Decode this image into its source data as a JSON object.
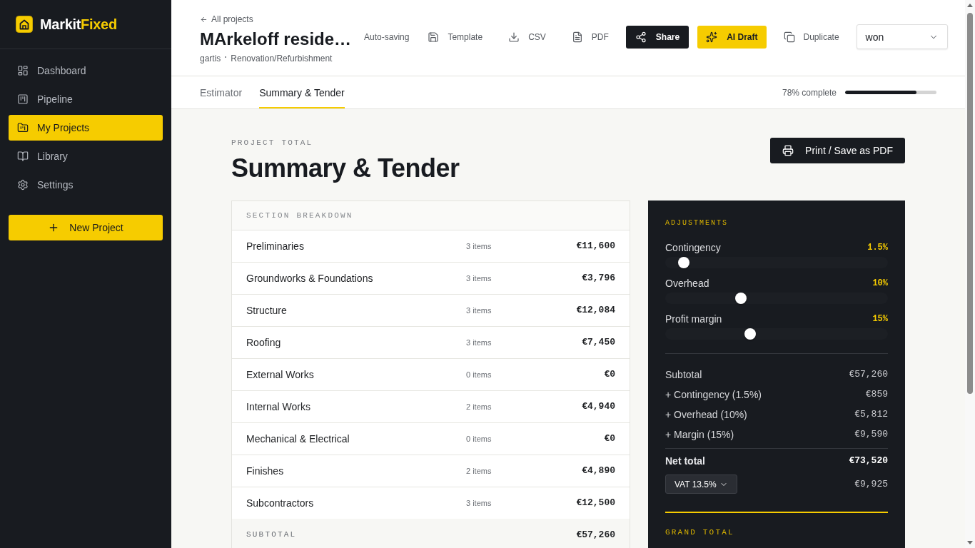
{
  "sidebar": {
    "brand": {
      "name": "Markit",
      "accent": "Fixed"
    },
    "items": [
      {
        "label": "Dashboard",
        "selected": false
      },
      {
        "label": "Pipeline",
        "selected": false
      },
      {
        "label": "My Projects",
        "selected": true
      },
      {
        "label": "Library",
        "selected": false
      },
      {
        "label": "Settings",
        "selected": false
      }
    ],
    "new_button": "New Project"
  },
  "header": {
    "back_link": "All projects",
    "title": "MArkeloff reside…",
    "client": "gartis",
    "project_type": "Renovation/Refurbishment",
    "actions": [
      {
        "kind": "status",
        "label": "Auto-saving"
      },
      {
        "kind": "ghost",
        "label": "Template"
      },
      {
        "kind": "ghost",
        "label": "CSV"
      },
      {
        "kind": "ghost",
        "label": "PDF"
      },
      {
        "kind": "dark",
        "label": "Share"
      },
      {
        "kind": "accent",
        "label": "AI Draft"
      },
      {
        "kind": "ghost",
        "label": "Duplicate"
      }
    ],
    "status_select": {
      "value": "won"
    }
  },
  "tabs": [
    {
      "label": "Estimator",
      "selected": false
    },
    {
      "label": "Summary & Tender",
      "selected": true
    }
  ],
  "progress": {
    "label": "78% complete",
    "level": 0.78
  },
  "page": {
    "eyebrow": "PROJECT TOTAL",
    "title": "Summary & Tender",
    "print_button": "Print / Save as PDF"
  },
  "breakdown": {
    "heading": "SECTION BREAKDOWN",
    "rows": [
      {
        "name": "Preliminaries",
        "items": "3 items",
        "amount": "€11,600"
      },
      {
        "name": "Groundworks & Foundations",
        "items": "3 items",
        "amount": "€3,796"
      },
      {
        "name": "Structure",
        "items": "3 items",
        "amount": "€12,084"
      },
      {
        "name": "Roofing",
        "items": "3 items",
        "amount": "€7,450"
      },
      {
        "name": "External Works",
        "items": "0 items",
        "amount": "€0"
      },
      {
        "name": "Internal Works",
        "items": "2 items",
        "amount": "€4,940"
      },
      {
        "name": "Mechanical & Electrical",
        "items": "0 items",
        "amount": "€0"
      },
      {
        "name": "Finishes",
        "items": "2 items",
        "amount": "€4,890"
      },
      {
        "name": "Subcontractors",
        "items": "3 items",
        "amount": "€12,500"
      }
    ],
    "subtotal": {
      "label": "SUBTOTAL",
      "amount": "€57,260"
    }
  },
  "adjustments_panel": {
    "heading": "ADJUSTMENTS",
    "adjustments": [
      {
        "label": "Contingency",
        "value": "1.5%",
        "level": 0.06
      },
      {
        "label": "Overhead",
        "value": "10%",
        "level": 0.33
      },
      {
        "label": "Profit margin",
        "value": "15%",
        "level": 0.375
      }
    ],
    "lines": [
      {
        "label": "Subtotal",
        "amount": "€57,260"
      },
      {
        "label": "+ Contingency (1.5%)",
        "amount": "€859"
      },
      {
        "label": "+ Overhead (10%)",
        "amount": "€5,812"
      },
      {
        "label": "+ Margin (15%)",
        "amount": "€9,590"
      }
    ],
    "net_total": {
      "label": "Net total",
      "amount": "€73,520"
    },
    "vat": {
      "select": "VAT 13.5%",
      "amount": "€9,925"
    },
    "grand_total": {
      "label": "GRAND TOTAL"
    }
  }
}
